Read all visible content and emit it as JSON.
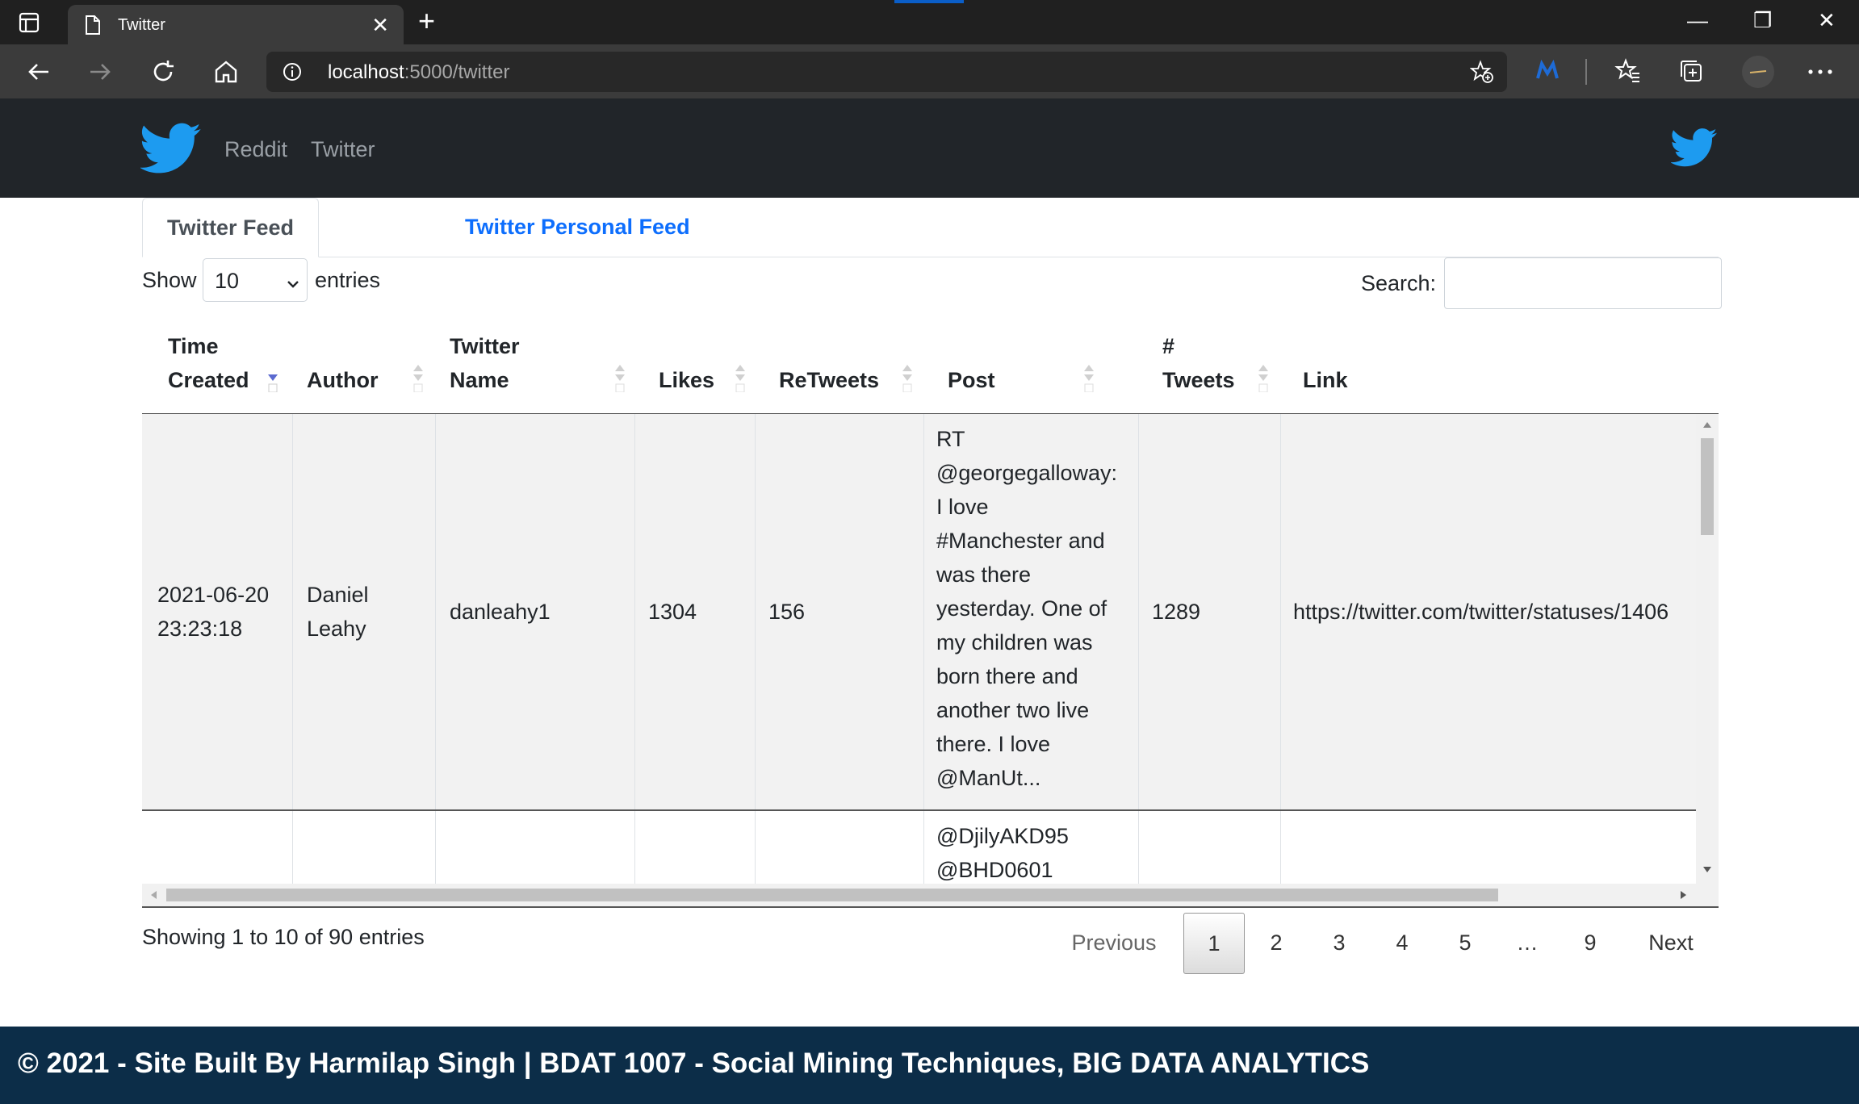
{
  "browser": {
    "tab_title": "Twitter",
    "url_host": "localhost",
    "url_path": ":5000/twitter",
    "icons": [
      "tab-actions-icon",
      "document-icon",
      "close-icon",
      "plus-icon",
      "back-icon",
      "forward-icon",
      "refresh-icon",
      "home-icon",
      "info-icon",
      "add-favorite-icon",
      "extension-icon",
      "favorites-icon",
      "collections-icon",
      "profile-icon",
      "more-icon",
      "minimize-icon",
      "restore-icon",
      "window-close-icon"
    ]
  },
  "navbar": {
    "links": [
      "Reddit",
      "Twitter"
    ],
    "brand_color": "#1d9bf0"
  },
  "tabs": {
    "active": "Twitter Feed",
    "other": "Twitter Personal Feed"
  },
  "controls": {
    "show_label": "Show",
    "length_value": "10",
    "entries_label": "entries",
    "search_label": "Search:",
    "search_value": ""
  },
  "table": {
    "headers": [
      {
        "line1": "Time",
        "line2": "Created"
      },
      {
        "line1": "",
        "line2": "Author"
      },
      {
        "line1": "Twitter",
        "line2": "Name"
      },
      {
        "line1": "",
        "line2": "Likes"
      },
      {
        "line1": "",
        "line2": "ReTweets"
      },
      {
        "line1": "",
        "line2": "Post"
      },
      {
        "line1": "#",
        "line2": "Tweets"
      },
      {
        "line1": "",
        "line2": "Link"
      }
    ],
    "rows": [
      {
        "time_line1": "2021-06-20",
        "time_line2": "23:23:18",
        "author_line1": "Daniel",
        "author_line2": "Leahy",
        "twitter_name": "danleahy1",
        "likes": "1304",
        "retweets": "156",
        "post_lines": [
          "RT",
          "@georgegalloway:",
          "I love",
          "#Manchester and",
          "was there",
          "yesterday. One of",
          "my children was",
          "born there and",
          "another two live",
          "there. I love",
          "@ManUt..."
        ],
        "tweets": "1289",
        "link": "https://twitter.com/twitter/statuses/1406"
      },
      {
        "post_lines": [
          "@DjilyAKD95",
          "@BHD0601"
        ]
      }
    ]
  },
  "pagination": {
    "info": "Showing 1 to 10 of 90 entries",
    "previous": "Previous",
    "pages": [
      "1",
      "2",
      "3",
      "4",
      "5",
      "…",
      "9"
    ],
    "current": "1",
    "next": "Next"
  },
  "footer": {
    "text": "© 2021 - Site Built By Harmilap Singh | BDAT 1007 - Social Mining Techniques, BIG DATA ANALYTICS"
  }
}
